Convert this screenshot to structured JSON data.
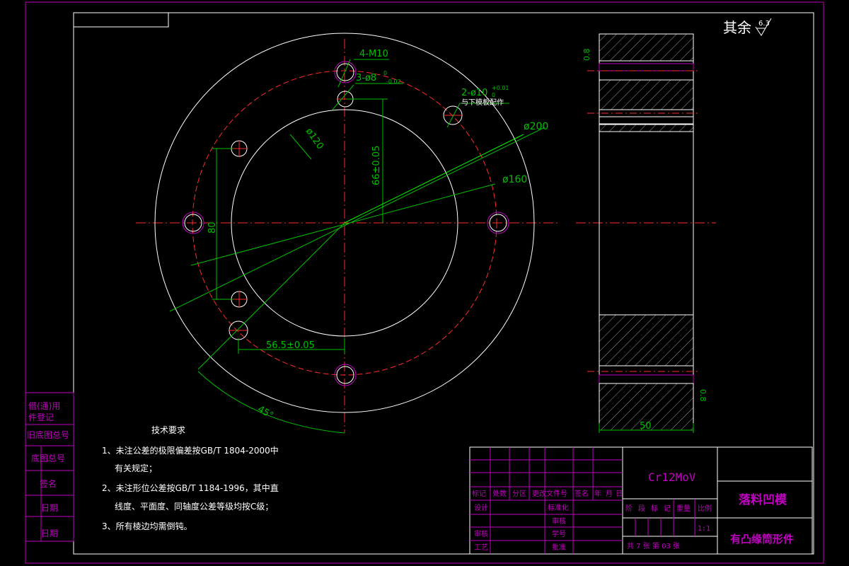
{
  "roughness": {
    "label": "其余",
    "value": "6.3"
  },
  "annotations": {
    "m10": "4-M10",
    "pin8": "3-ø8",
    "pin8_tol": "0",
    "pin8_tol2": "-0.02",
    "pin10": "2-ø10",
    "pin10_tol_up": "+0.01",
    "pin10_tol_low": "0",
    "pin10_note": "与下模板配作",
    "d200": "ø200",
    "d160": "ø160",
    "d120": "ø120",
    "dim66": "66±0.05",
    "dim80": "80",
    "dim565": "56.5±0.05",
    "angle45": "45°",
    "side_r1": "0.8",
    "side_r2": "0.8",
    "side_w": "50"
  },
  "tech": {
    "title": "技术要求",
    "l1a": "1、未注公差的极限偏差按GB/T 1804-2000中",
    "l1b": "有关规定；",
    "l2a": "2、未注形位公差按GB/T 1184-1996，其中直",
    "l2b": "线度、平面度、同轴度公差等级均按C级；",
    "l3": "3、所有棱边均需倒钝。"
  },
  "left_stamp": [
    "借(通)用",
    "件登记",
    "旧底图总号",
    "底图总号",
    "签名",
    "日期",
    "日期"
  ],
  "title_block": {
    "material": "Cr12MoV",
    "name": "落料凹模",
    "assembly": "有凸缘筒形件",
    "rev_header": [
      "标记",
      "处数",
      "分区",
      "更改文件号",
      "签名",
      "年",
      "月",
      "日"
    ],
    "design": "设计",
    "standard": "标准化",
    "review": "审核",
    "check": "审核",
    "process": "工艺",
    "approve": "批准",
    "stage_header": [
      "阶",
      "段",
      "标",
      "记",
      "重量",
      "比例"
    ],
    "scale": "1:1",
    "sheets": "共 7 张  第 03 张",
    "proof": "审核",
    "learn": "学号"
  }
}
